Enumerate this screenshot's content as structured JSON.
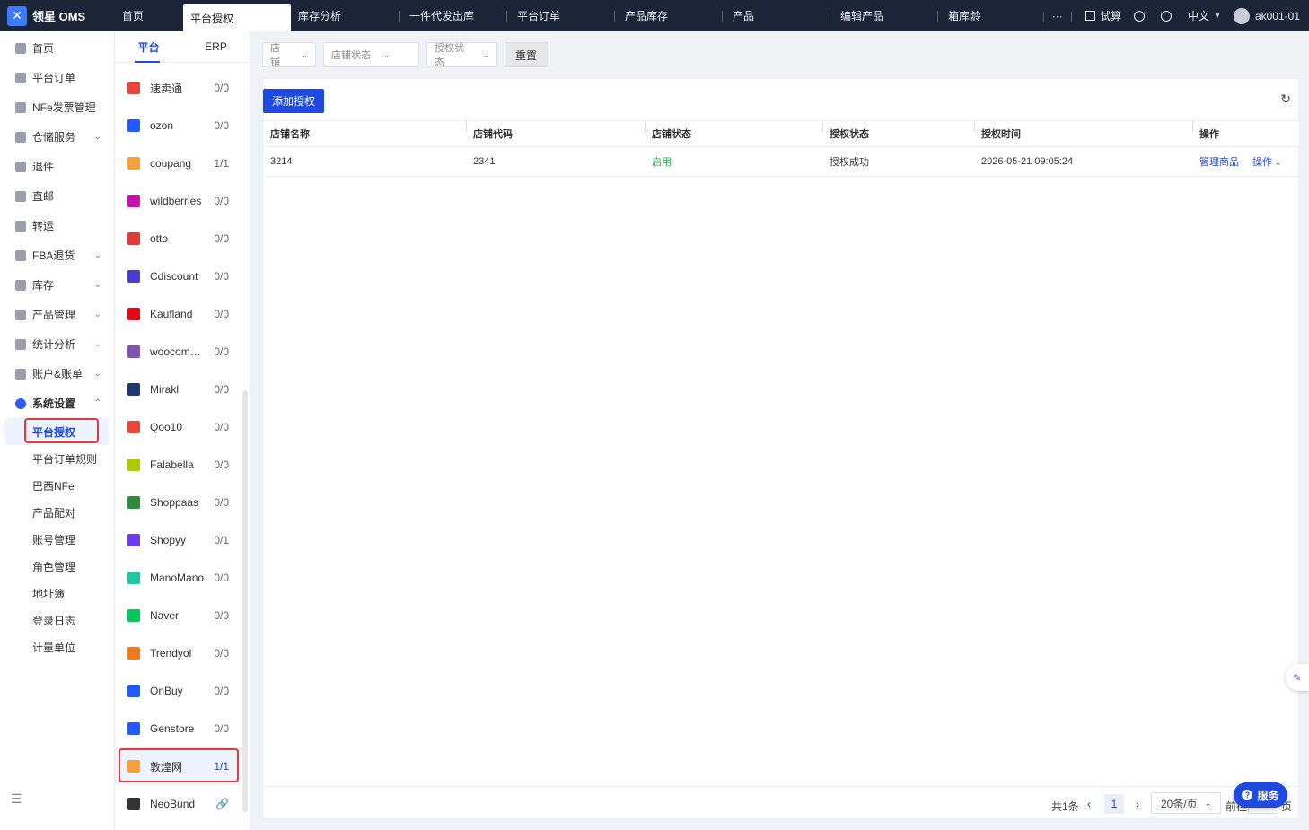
{
  "app": {
    "name": "领星 OMS"
  },
  "header": {
    "tabs": [
      {
        "label": "首页"
      },
      {
        "label": "平台授权"
      },
      {
        "label": "库存分析"
      },
      {
        "label": "一件代发出库"
      },
      {
        "label": "平台订单"
      },
      {
        "label": "产品库存"
      },
      {
        "label": "产品"
      },
      {
        "label": "编辑产品"
      },
      {
        "label": "箱库龄"
      }
    ],
    "more": "···",
    "trial": "试算",
    "language": "中文",
    "user": "ak001-01"
  },
  "sidebar": {
    "items": [
      {
        "label": "首页",
        "arrow": ""
      },
      {
        "label": "平台订单",
        "arrow": ""
      },
      {
        "label": "NFe发票管理",
        "arrow": ""
      },
      {
        "label": "仓储服务",
        "arrow": "⌄"
      },
      {
        "label": "退件",
        "arrow": ""
      },
      {
        "label": "直邮",
        "arrow": ""
      },
      {
        "label": "转运",
        "arrow": ""
      },
      {
        "label": "FBA退货",
        "arrow": "⌄"
      },
      {
        "label": "库存",
        "arrow": "⌄"
      },
      {
        "label": "产品管理",
        "arrow": "⌄"
      },
      {
        "label": "统计分析",
        "arrow": "⌄"
      },
      {
        "label": "账户&账单",
        "arrow": "⌄"
      },
      {
        "label": "系统设置",
        "arrow": "⌃"
      }
    ],
    "sub_items": [
      {
        "label": "平台授权"
      },
      {
        "label": "平台订单规则"
      },
      {
        "label": "巴西NFe"
      },
      {
        "label": "产品配对"
      },
      {
        "label": "账号管理"
      },
      {
        "label": "角色管理"
      },
      {
        "label": "地址簿"
      },
      {
        "label": "登录日志"
      },
      {
        "label": "计量单位"
      }
    ]
  },
  "platform_panel": {
    "tabs": [
      {
        "label": "平台"
      },
      {
        "label": "ERP"
      }
    ],
    "platforms": [
      {
        "name": "速卖通",
        "count": "0/0",
        "icon": "aliexpress-icon",
        "color": "#e8463a"
      },
      {
        "name": "ozon",
        "count": "0/0",
        "icon": "ozon-icon",
        "color": "#1f5bff"
      },
      {
        "name": "coupang",
        "count": "1/1",
        "icon": "coupang-icon",
        "color": "#f4a13a"
      },
      {
        "name": "wildberries",
        "count": "0/0",
        "icon": "wildberries-icon",
        "color": "#cb11ab"
      },
      {
        "name": "otto",
        "count": "0/0",
        "icon": "otto-icon",
        "color": "#e03a3a"
      },
      {
        "name": "Cdiscount",
        "count": "0/0",
        "icon": "cdiscount-icon",
        "color": "#4b3cd6"
      },
      {
        "name": "Kaufland",
        "count": "0/0",
        "icon": "kaufland-icon",
        "color": "#e10915"
      },
      {
        "name": "woocommerce",
        "count": "0/0",
        "icon": "woocommerce-icon",
        "color": "#7f54b3"
      },
      {
        "name": "Mirakl",
        "count": "0/0",
        "icon": "mirakl-icon",
        "color": "#1c3a6e"
      },
      {
        "name": "Qoo10",
        "count": "0/0",
        "icon": "qoo10-icon",
        "color": "#e8463a"
      },
      {
        "name": "Falabella",
        "count": "0/0",
        "icon": "falabella-icon",
        "color": "#aacc00"
      },
      {
        "name": "Shoppaas",
        "count": "0/0",
        "icon": "shoppaas-icon",
        "color": "#2e8b3a"
      },
      {
        "name": "Shopyy",
        "count": "0/1",
        "icon": "shopyy-icon",
        "color": "#6b3cf0"
      },
      {
        "name": "ManoMano",
        "count": "0/0",
        "icon": "manomano-icon",
        "color": "#1ec8a0"
      },
      {
        "name": "Naver",
        "count": "0/0",
        "icon": "naver-icon",
        "color": "#03c75a"
      },
      {
        "name": "Trendyol",
        "count": "0/0",
        "icon": "trendyol-icon",
        "color": "#f27a1a"
      },
      {
        "name": "OnBuy",
        "count": "0/0",
        "icon": "onbuy-icon",
        "color": "#1f5bff"
      },
      {
        "name": "Genstore",
        "count": "0/0",
        "icon": "genstore-icon",
        "color": "#1f5bff"
      },
      {
        "name": "敦煌网",
        "count": "1/1",
        "icon": "dhgate-icon",
        "color": "#f4a13a"
      },
      {
        "name": "NeoBund",
        "count": "🔗",
        "icon": "neobund-icon",
        "color": "#333333"
      }
    ]
  },
  "filters": {
    "store": "店铺",
    "store_status": "店铺状态",
    "auth_status": "授权状态",
    "reset": "重置"
  },
  "actions": {
    "add_auth": "添加授权"
  },
  "table": {
    "headers": [
      "店铺名称",
      "店铺代码",
      "店铺状态",
      "授权状态",
      "授权时间",
      "操作"
    ],
    "rows": [
      {
        "store_name": "3214",
        "store_code": "2341",
        "store_status": "启用",
        "auth_status": "授权成功",
        "auth_time": "2026-05-21 09:05:24",
        "manage": "管理商品",
        "op": "操作"
      }
    ]
  },
  "pagination": {
    "total": "共1条",
    "page": "1",
    "page_size": "20条/页",
    "goto": "前往",
    "page_suffix": "页"
  },
  "service": {
    "label": "服务"
  },
  "colors": {
    "accent": "#1f49e0",
    "topbar": "#1c2438",
    "success": "#2eaa54",
    "highlight": "#e03a3a"
  }
}
